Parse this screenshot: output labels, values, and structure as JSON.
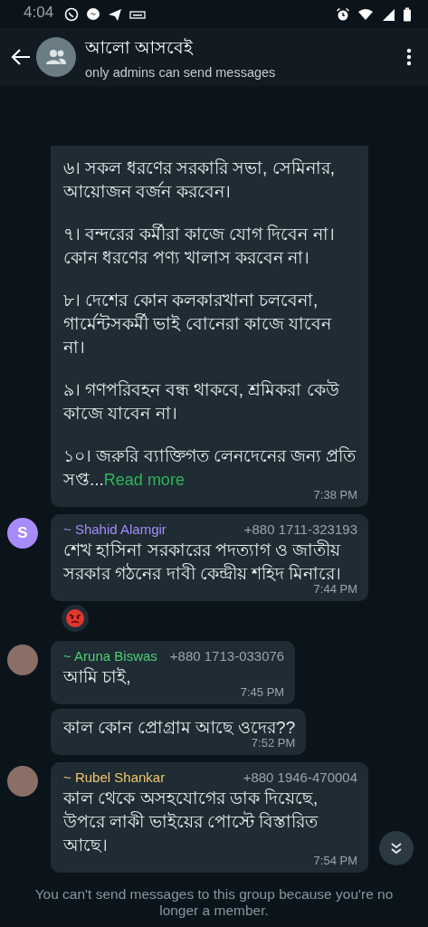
{
  "status_bar": {
    "time": "4:04"
  },
  "header": {
    "title": "আলো আসবেই",
    "subtitle": "only admins can send messages"
  },
  "messages": [
    {
      "kind": "continued",
      "paragraphs": [
        "৬। সকল ধরণের সরকারি সভা, সেমিনার, আয়োজন বর্জন করবেন।",
        "৭। বন্দরের কর্মীরা কাজে যোগ দিবেন না। কোন ধরণের পণ্য খালাস করবেন না।",
        "৮। দেশের কোন কলকারখানা চলবেনা, গার্মেন্টসকর্মী ভাই বোনেরা কাজে যাবেন না।",
        "৯। গণপরিবহন বন্ধ থাকবে, শ্রমিকরা কেউ কাজে যাবেন না।",
        "১০। জরুরি ব্যাক্তিগত লেনদেনের জন্য প্রতি সপ্ত..."
      ],
      "read_more": "Read more",
      "time": "7:38 PM"
    },
    {
      "kind": "first",
      "avatar": {
        "kind": "letter",
        "letter": "S",
        "color": "#a78bfa"
      },
      "sender": "~ Shahid Alamgir",
      "color": "#a78bfa",
      "phone": "+880 1711-323193",
      "paragraphs": [
        "শেখ হাসিনা সরকারের পদত্যাগ ও জাতীয় সরকার গঠনের দাবী কেন্দ্রীয় শহিদ মিনারে।"
      ],
      "time": "7:44 PM",
      "reacted": true
    },
    {
      "kind": "first",
      "avatar": {
        "kind": "photo"
      },
      "sender": "~ Aruna Biswas",
      "color": "#4fd07a",
      "phone": "+880 1713-033076",
      "paragraphs": [
        "আমি চাই,"
      ],
      "time": "7:45 PM"
    },
    {
      "kind": "continued",
      "paragraphs": [
        "কাল কোন প্রোগ্রাম আছে ওদের??"
      ],
      "time": "7:52 PM"
    },
    {
      "kind": "first",
      "avatar": {
        "kind": "photo"
      },
      "sender": "~ Rubel Shankar",
      "color": "#f2c66d",
      "phone": "+880 1946-470004",
      "paragraphs": [
        "কাল থেকে অসহযোগের ডাক দিয়েছে, উপরে লাকী ভাইয়ের পোস্টে বিস্তারিত আছে।"
      ],
      "time": "7:54 PM"
    }
  ],
  "footer": "You can't send messages to this group because you're no longer a member."
}
